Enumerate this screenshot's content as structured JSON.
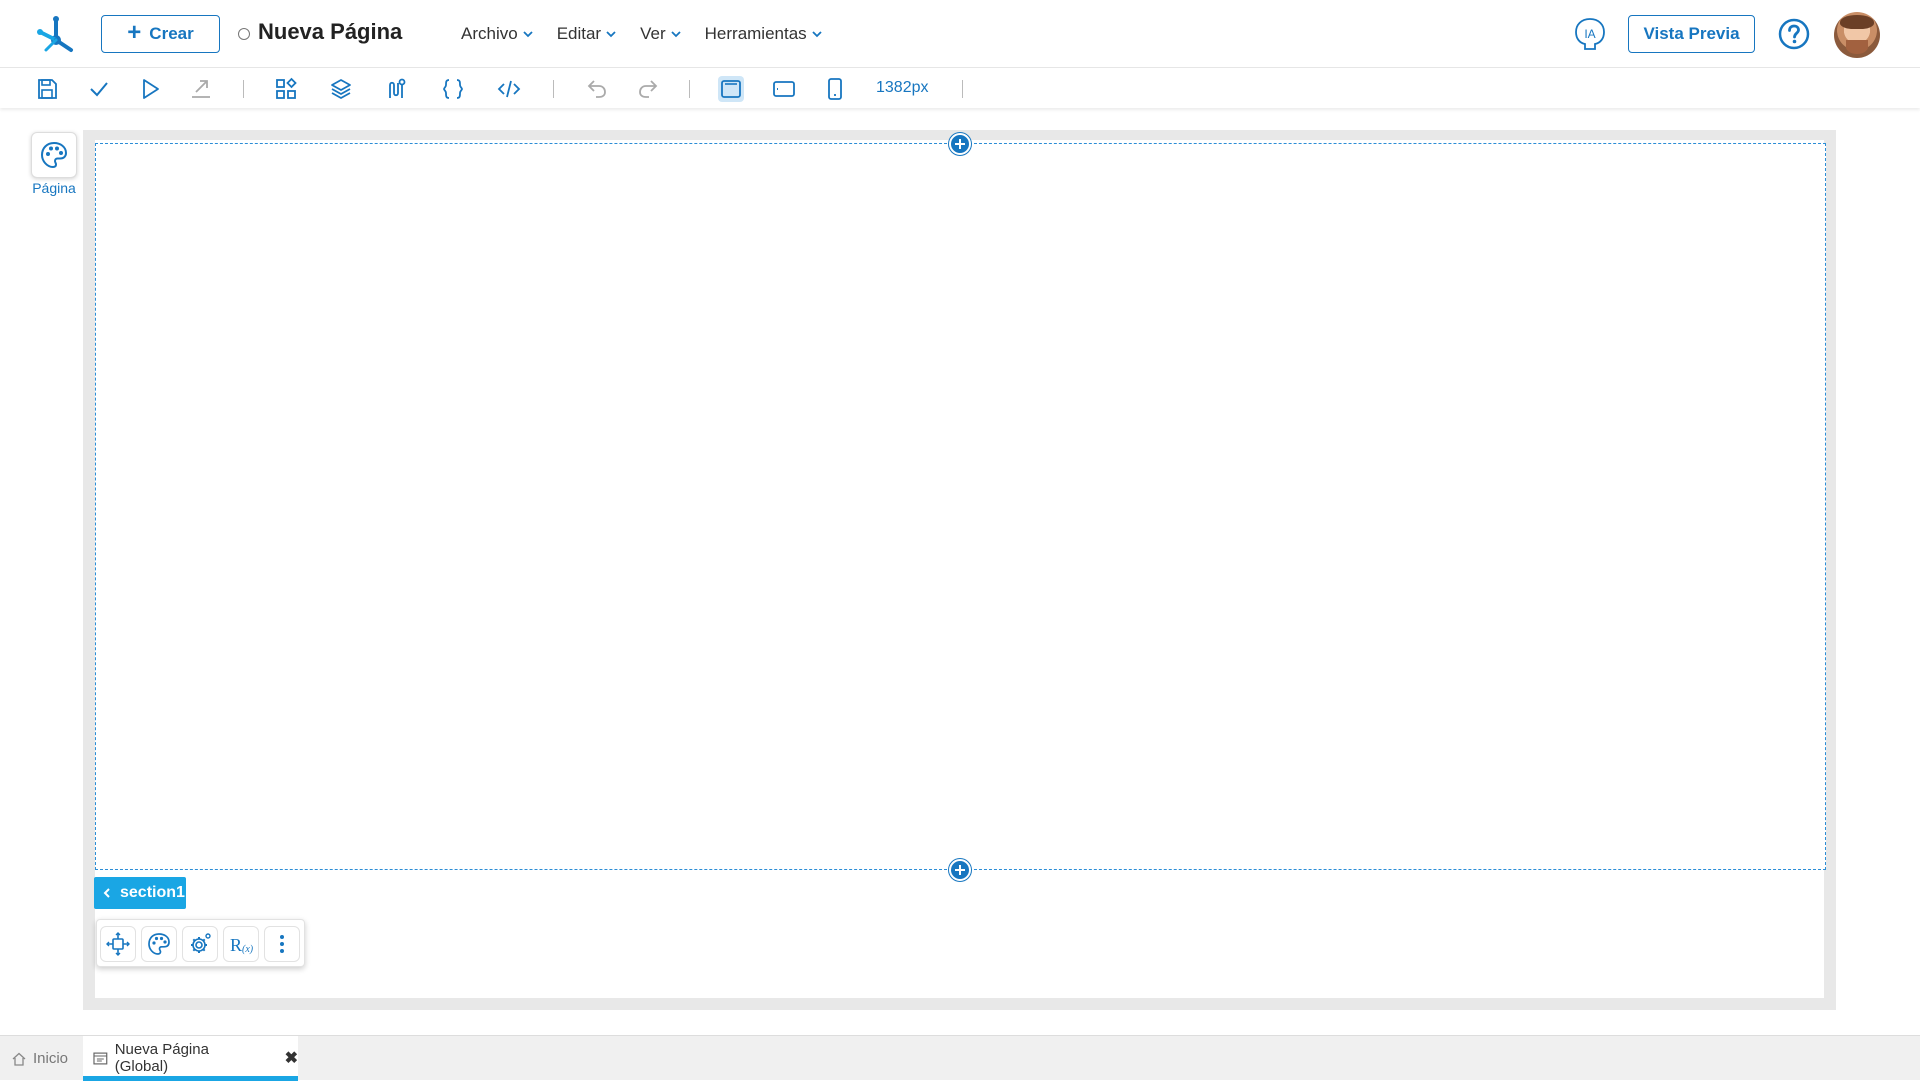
{
  "app": {
    "title": "Nueva Página",
    "create_label": "Crear",
    "preview_label": "Vista Previa",
    "ia_label": "IA"
  },
  "menu": [
    {
      "label": "Archivo"
    },
    {
      "label": "Editar"
    },
    {
      "label": "Ver"
    },
    {
      "label": "Herramientas"
    }
  ],
  "toolbar": {
    "width_value": "1382px",
    "icons": [
      "save-icon",
      "check-icon",
      "play-icon",
      "export-icon",
      "components-icon",
      "layers-icon",
      "flow-icon",
      "braces-icon",
      "code-icon",
      "undo-icon",
      "redo-icon",
      "desktop-view-icon",
      "tablet-view-icon",
      "mobile-view-icon"
    ],
    "active_view": "desktop"
  },
  "sidebar": {
    "palette_label": "Página"
  },
  "canvas": {
    "section_name": "section1",
    "section_tools": [
      "move-icon",
      "palette-icon",
      "settings-icon",
      "rule-icon",
      "more-icon"
    ]
  },
  "tabs": [
    {
      "label": "Inicio",
      "active": false
    },
    {
      "label": "Nueva Página (Global)",
      "active": true
    }
  ],
  "colors": {
    "accent": "#1776c0",
    "section_tag": "#1aa6e4",
    "canvas_bg": "#e8e8e8"
  }
}
